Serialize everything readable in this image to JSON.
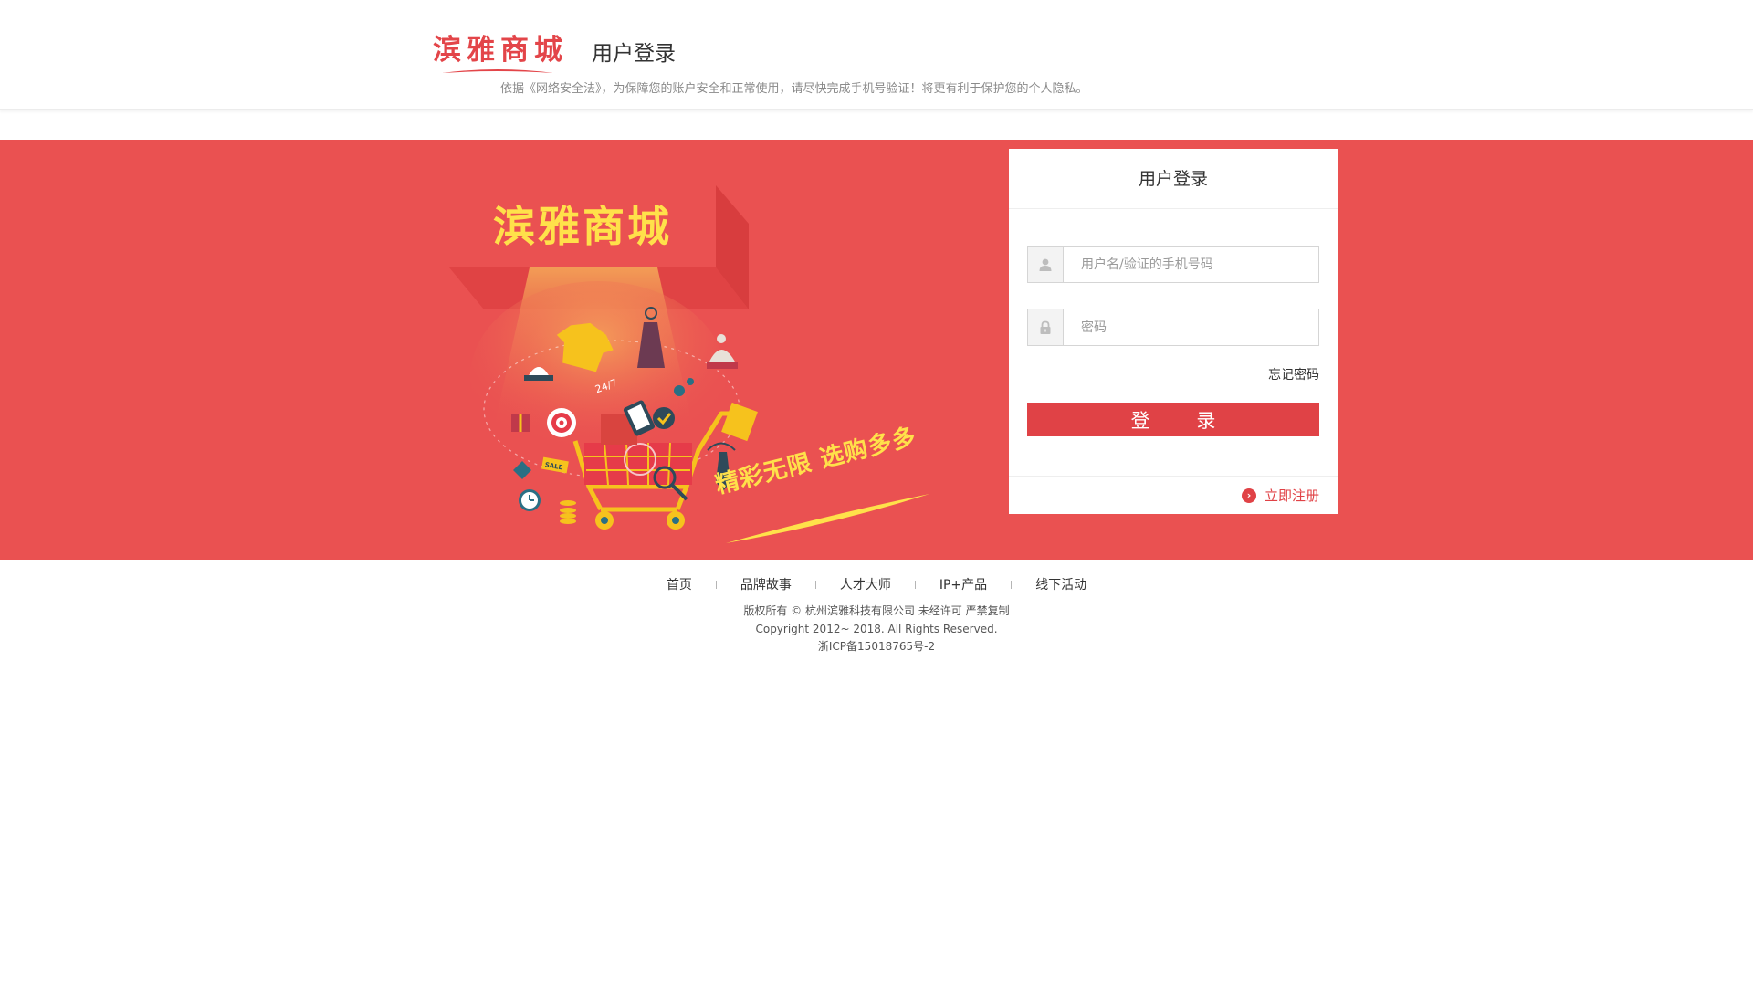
{
  "header": {
    "logo_text": "滨雅商城",
    "page_title": "用户登录",
    "notice": "依据《网络安全法》，为保障您的账户安全和正常使用，请尽快完成手机号验证！将更有利于保护您的个人隐私。"
  },
  "banner": {
    "promo_title": "滨雅商城",
    "slogan": "精彩无限  选购多多",
    "colors": {
      "background": "#ea5151",
      "accent": "#ffe14a"
    }
  },
  "login_card": {
    "title": "用户登录",
    "username_placeholder": "用户名/验证的手机号码",
    "password_placeholder": "密码",
    "forgot_password": "忘记密码",
    "login_button": "登 录",
    "register_link": "立即注册",
    "icons": {
      "username": "user-icon",
      "password": "lock-icon",
      "register": "chevron-right-circle-icon"
    },
    "colors": {
      "button": "#e04246"
    }
  },
  "footer": {
    "nav": [
      "首页",
      "品牌故事",
      "人才大师",
      "IP+产品",
      "线下活动"
    ],
    "copyright": "版权所有 © 杭州滨雅科技有限公司 未经许可 严禁复制",
    "rights": "Copyright 2012~ 2018. All Rights Reserved.",
    "icp": "浙ICP备15018765号-2"
  }
}
